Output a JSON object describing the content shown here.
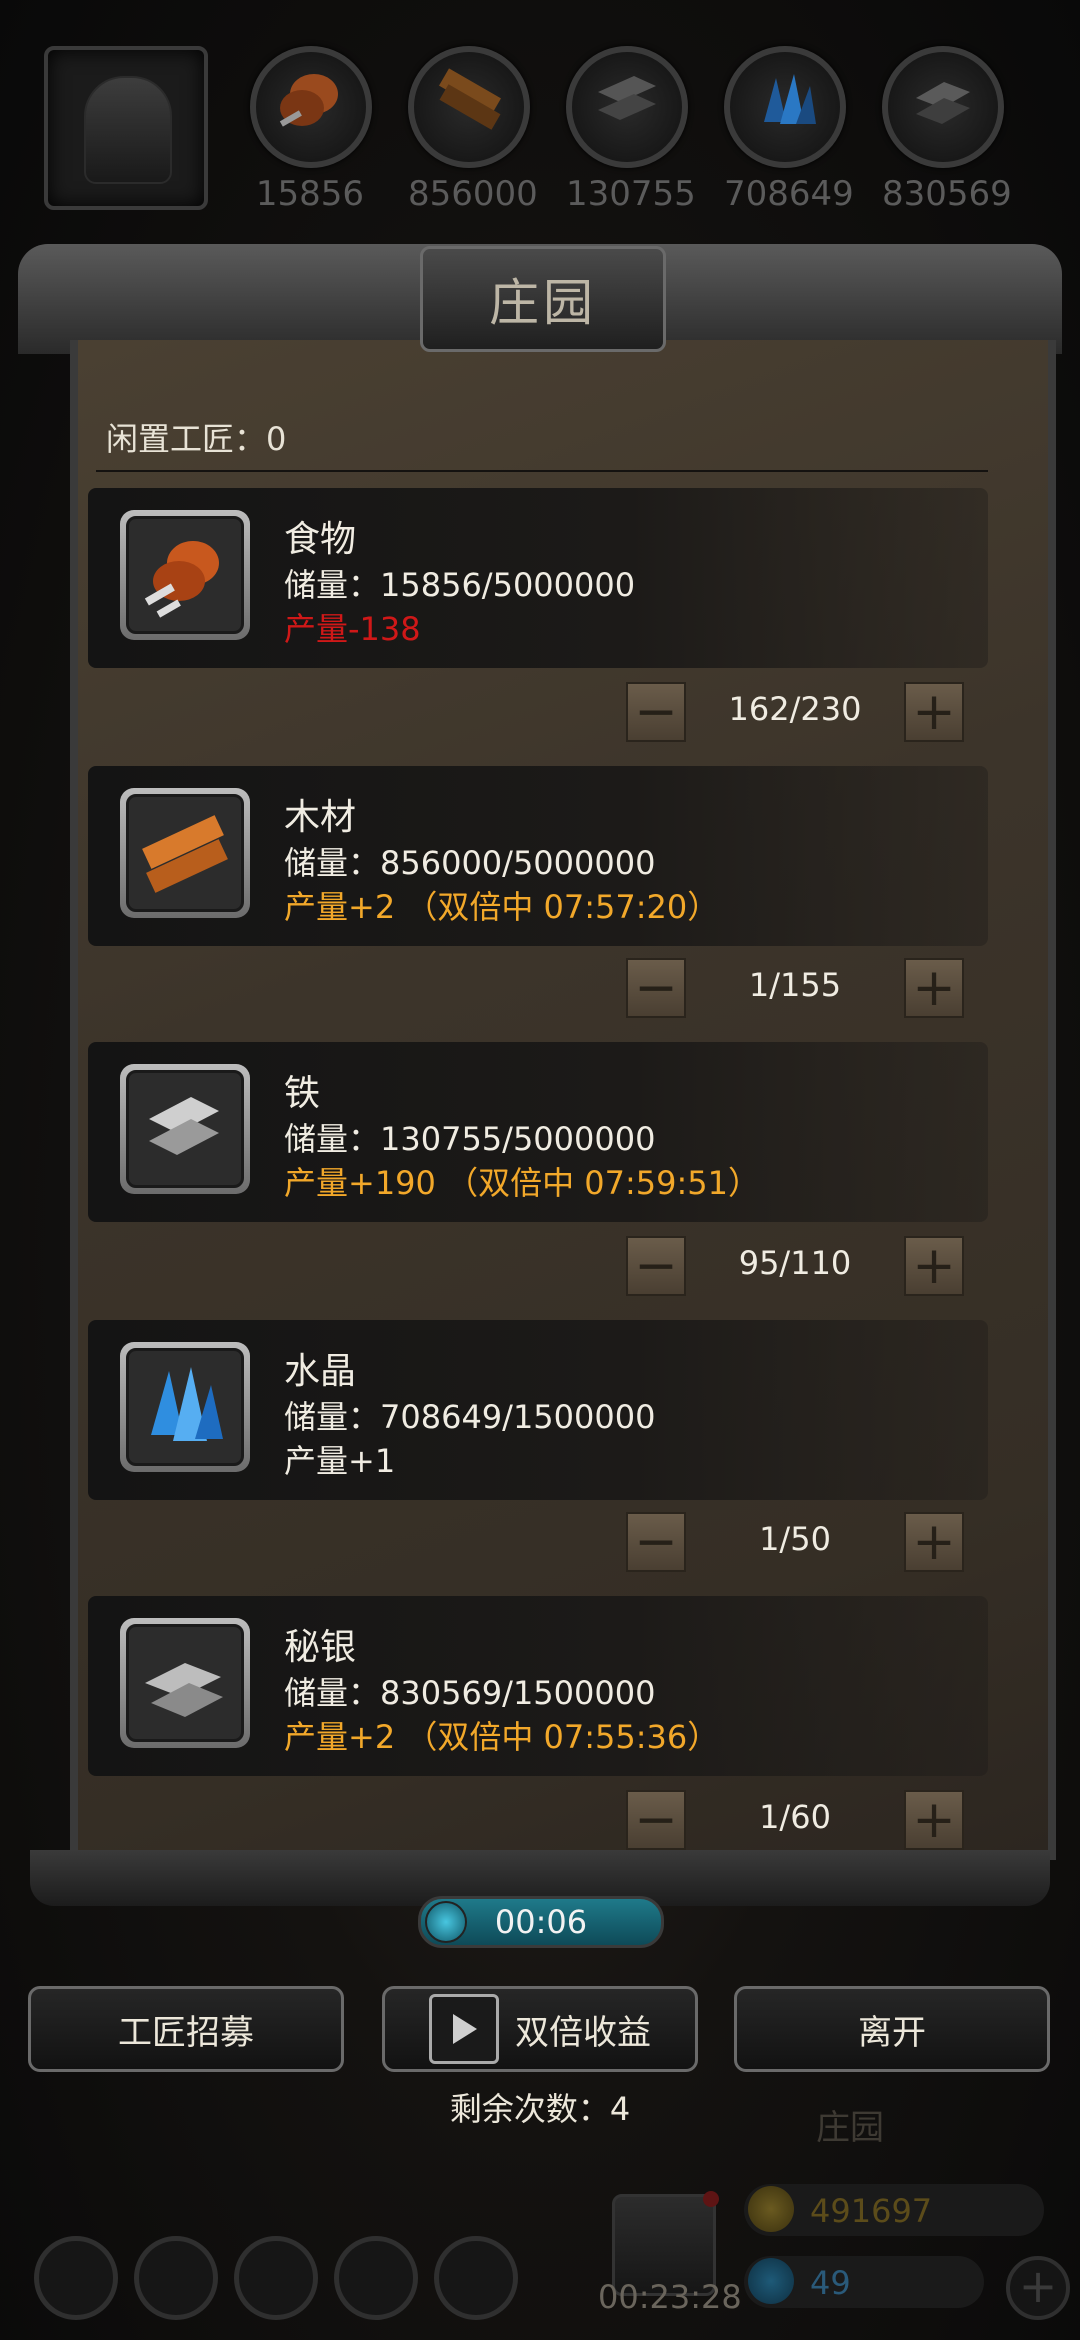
{
  "top_resources": [
    {
      "icon": "food-icon",
      "value": "15856"
    },
    {
      "icon": "wood-icon",
      "value": "856000"
    },
    {
      "icon": "iron-icon",
      "value": "130755"
    },
    {
      "icon": "crystal-icon",
      "value": "708649"
    },
    {
      "icon": "mithril-icon",
      "value": "830569"
    }
  ],
  "panel": {
    "title": "庄园",
    "idle_workers": "闲置工匠：0"
  },
  "resources": [
    {
      "name": "食物",
      "storage": "储量：15856/5000000",
      "production": "产量-138",
      "production_style": "negative",
      "workers": "162/230",
      "icon": "food-icon"
    },
    {
      "name": "木材",
      "storage": "储量：856000/5000000",
      "production": "产量+2 （双倍中 07:57:20）",
      "production_style": "boosted",
      "workers": "1/155",
      "icon": "wood-icon"
    },
    {
      "name": "铁",
      "storage": "储量：130755/5000000",
      "production": "产量+190 （双倍中 07:59:51）",
      "production_style": "boosted",
      "workers": "95/110",
      "icon": "iron-icon"
    },
    {
      "name": "水晶",
      "storage": "储量：708649/1500000",
      "production": "产量+1",
      "production_style": "normal",
      "workers": "1/50",
      "icon": "crystal-icon"
    },
    {
      "name": "秘银",
      "storage": "储量：830569/1500000",
      "production": "产量+2 （双倍中 07:55:36）",
      "production_style": "boosted",
      "workers": "1/60",
      "icon": "mithril-icon"
    }
  ],
  "stepper": {
    "minus": "−",
    "plus": "+"
  },
  "timer": "00:06",
  "actions": {
    "recruit": "工匠招募",
    "double": "双倍收益",
    "leave": "离开",
    "remaining": "剩余次数：4"
  },
  "bottom_bar": {
    "label": "庄园",
    "chest_timer": "00:23:28",
    "gold": "491697",
    "gems": "49",
    "add": "+"
  },
  "colors": {
    "negative": "#d01818",
    "boosted": "#f2a82a",
    "normal": "#f0ece2"
  }
}
